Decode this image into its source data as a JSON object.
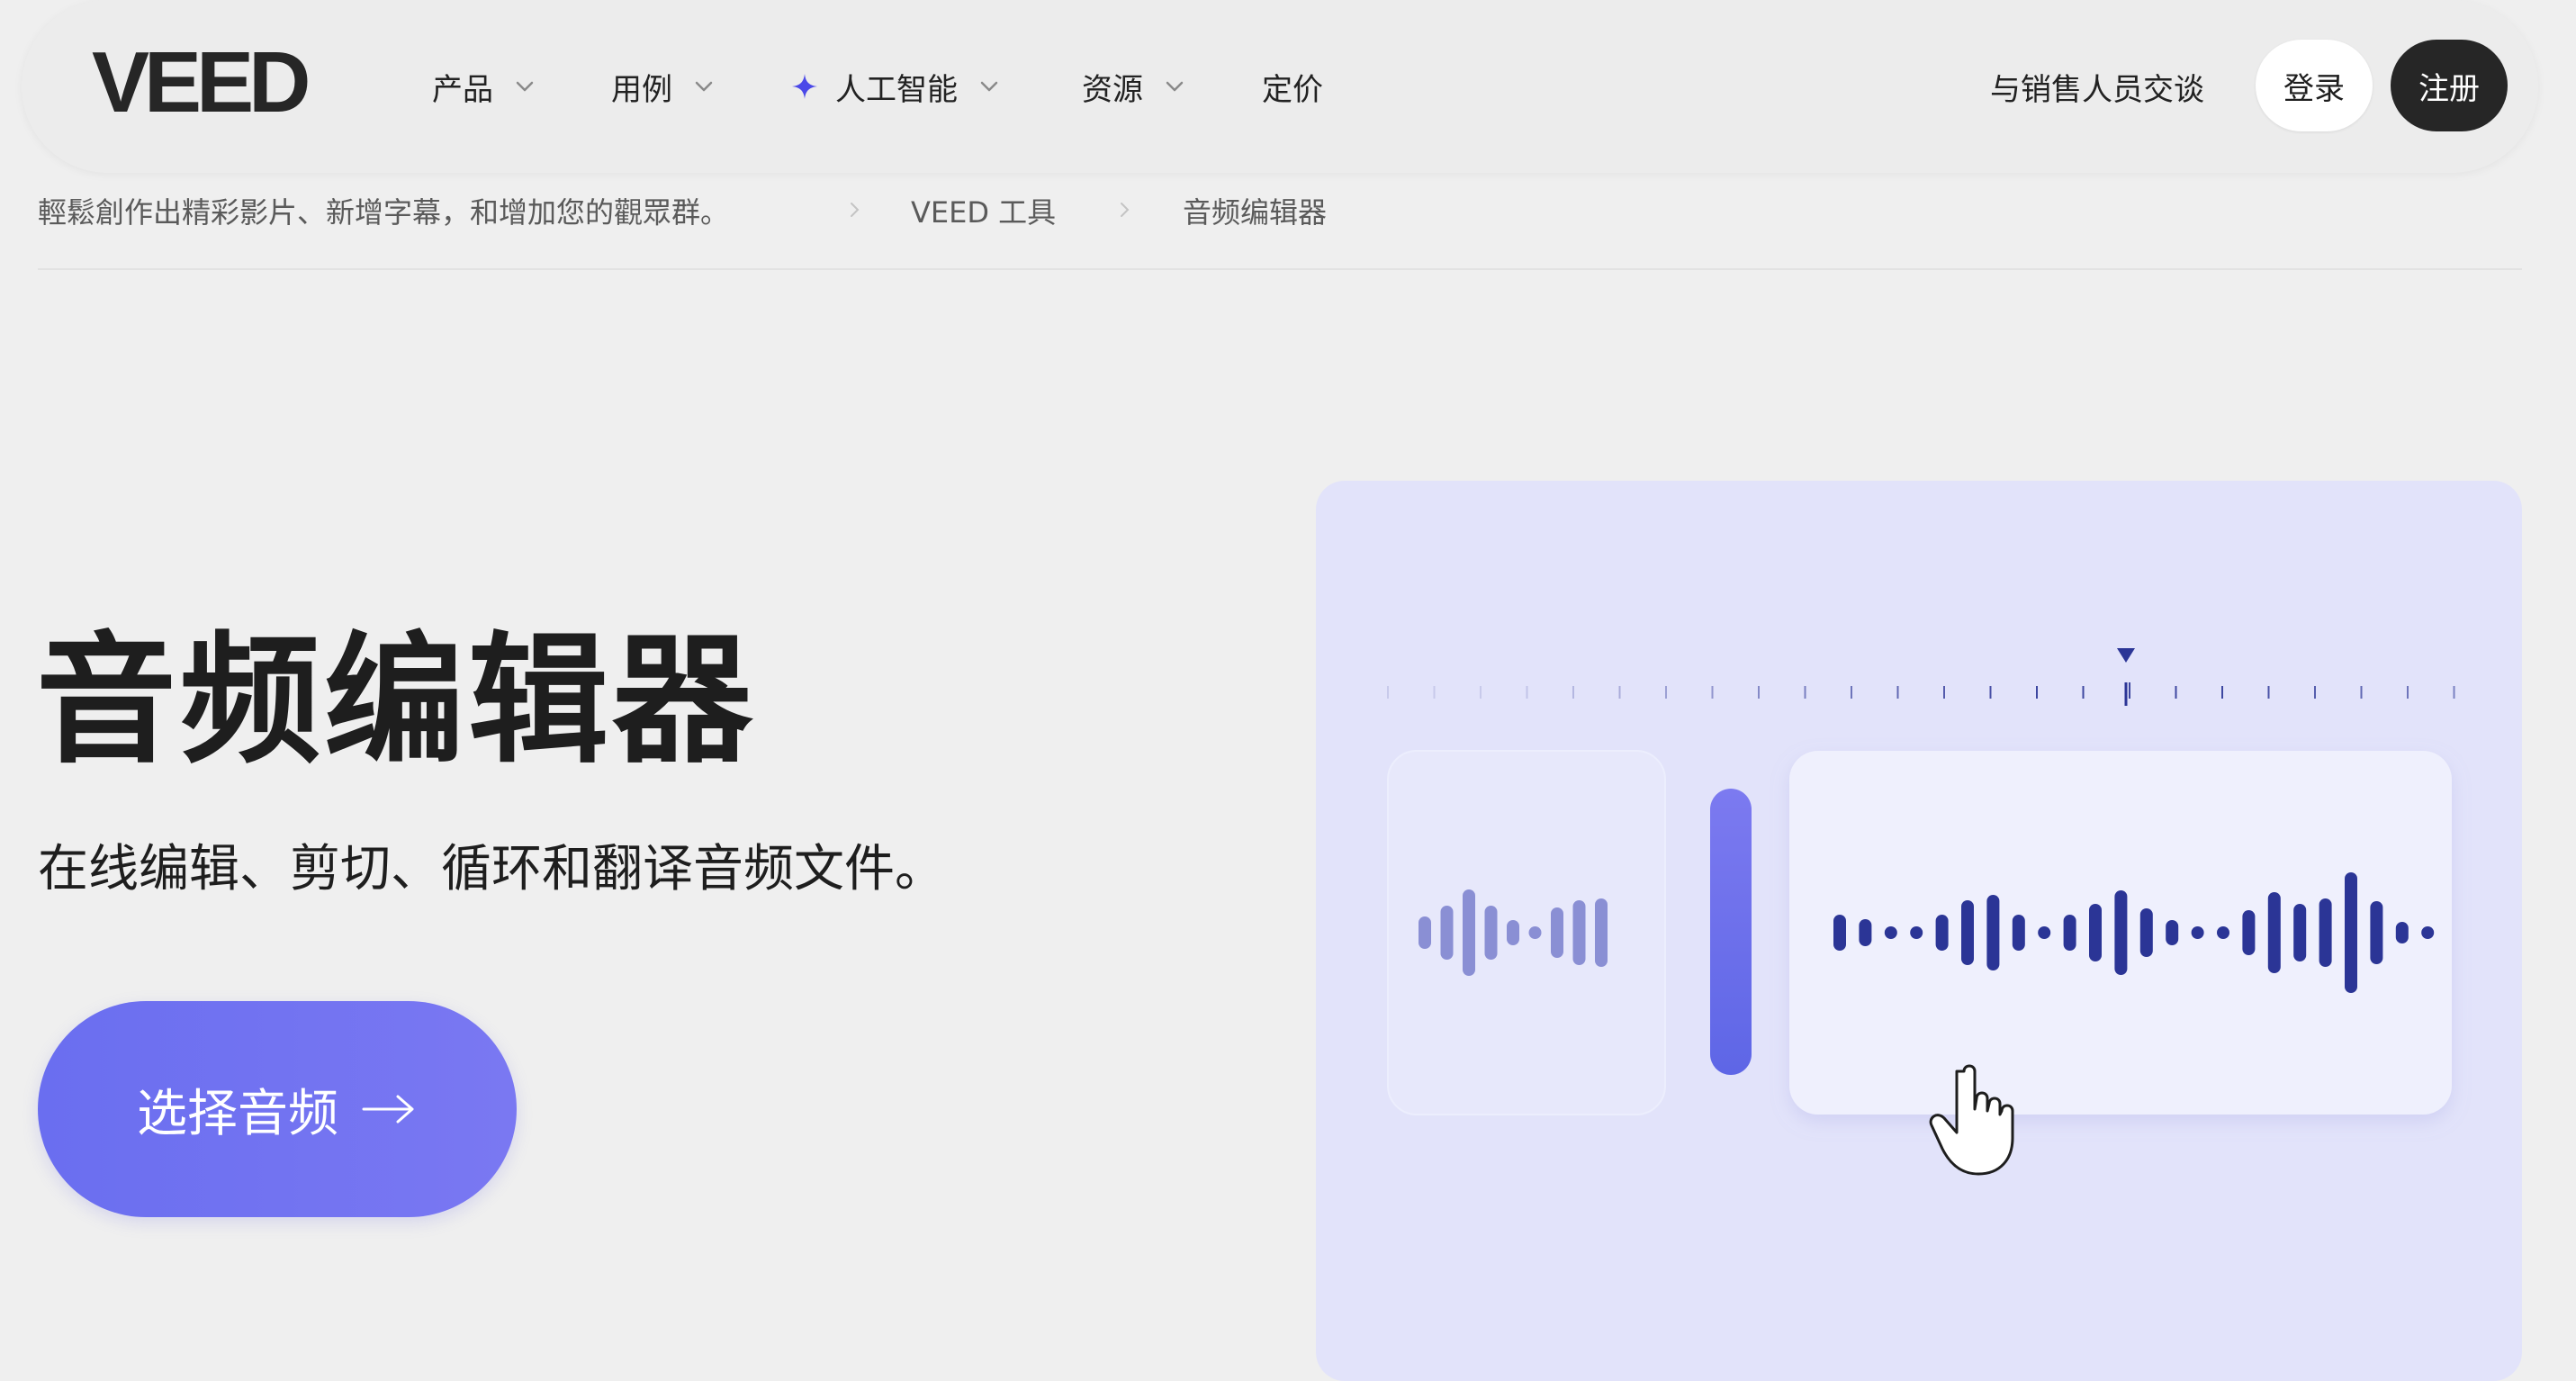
{
  "nav": {
    "logo_text": "VEED",
    "items": [
      {
        "label": "产品",
        "has_dropdown": true
      },
      {
        "label": "用例",
        "has_dropdown": true
      },
      {
        "label": "人工智能",
        "has_dropdown": true,
        "icon": "sparkle-icon"
      },
      {
        "label": "资源",
        "has_dropdown": true
      },
      {
        "label": "定价",
        "has_dropdown": false
      }
    ],
    "sales_label": "与销售人员交谈",
    "login_label": "登录",
    "signup_label": "注册"
  },
  "breadcrumb": [
    {
      "label": "輕鬆創作出精彩影片、新增字幕，和增加您的觀眾群。"
    },
    {
      "label": "VEED 工具"
    },
    {
      "label": "音频编辑器"
    }
  ],
  "hero": {
    "title": "音频编辑器",
    "subtitle": "在线编辑、剪切、循环和翻译音频文件。",
    "cta_label": "选择音频"
  },
  "colors": {
    "accent": "#6a6ef0",
    "illustration_bg": "#e2e3fa",
    "waveform_dark": "#2b3596",
    "waveform_light": "#8a8fd4",
    "playhead_bar": "#6a6ef0",
    "signup_bg": "#262626"
  },
  "icons": {
    "chevron": "chevron-down-icon",
    "sparkle": "sparkle-icon",
    "crumb_separator": "chevron-right-icon",
    "cta_arrow": "arrow-right-icon",
    "cursor": "hand-pointer-icon"
  }
}
